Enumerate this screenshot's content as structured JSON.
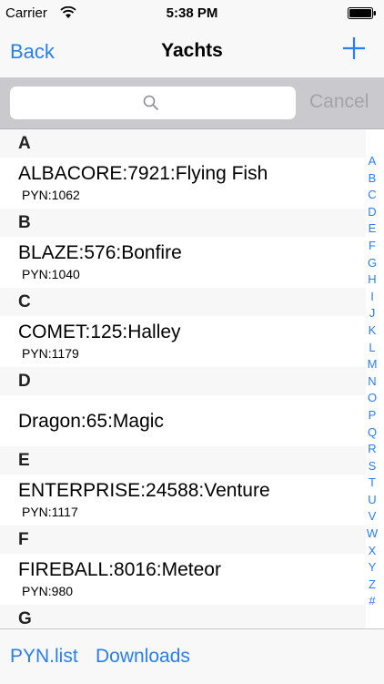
{
  "status": {
    "carrier": "Carrier",
    "time": "5:38 PM"
  },
  "nav": {
    "back": "Back",
    "title": "Yachts"
  },
  "search": {
    "placeholder": "",
    "cancel": "Cancel"
  },
  "sections": [
    {
      "letter": "A",
      "name": "ALBACORE:7921:Flying Fish",
      "pyn": "PYN:1062"
    },
    {
      "letter": "B",
      "name": "BLAZE:576:Bonfire",
      "pyn": "PYN:1040"
    },
    {
      "letter": "C",
      "name": "COMET:125:Halley",
      "pyn": "PYN:1179"
    },
    {
      "letter": "D",
      "name": "Dragon:65:Magic",
      "pyn": ""
    },
    {
      "letter": "E",
      "name": "ENTERPRISE:24588:Venture",
      "pyn": "PYN:1117"
    },
    {
      "letter": "F",
      "name": "FIREBALL:8016:Meteor",
      "pyn": "PYN:980"
    },
    {
      "letter": "G"
    }
  ],
  "index": [
    "A",
    "B",
    "C",
    "D",
    "E",
    "F",
    "G",
    "H",
    "I",
    "J",
    "K",
    "L",
    "M",
    "N",
    "O",
    "P",
    "Q",
    "R",
    "S",
    "T",
    "U",
    "V",
    "W",
    "X",
    "Y",
    "Z",
    "#"
  ],
  "toolbar": {
    "pyn_list": "PYN.list",
    "downloads": "Downloads"
  },
  "colors": {
    "accent": "#2a7ef1",
    "bar": "#f8f8f8",
    "search_bg": "#c9c9ce"
  }
}
